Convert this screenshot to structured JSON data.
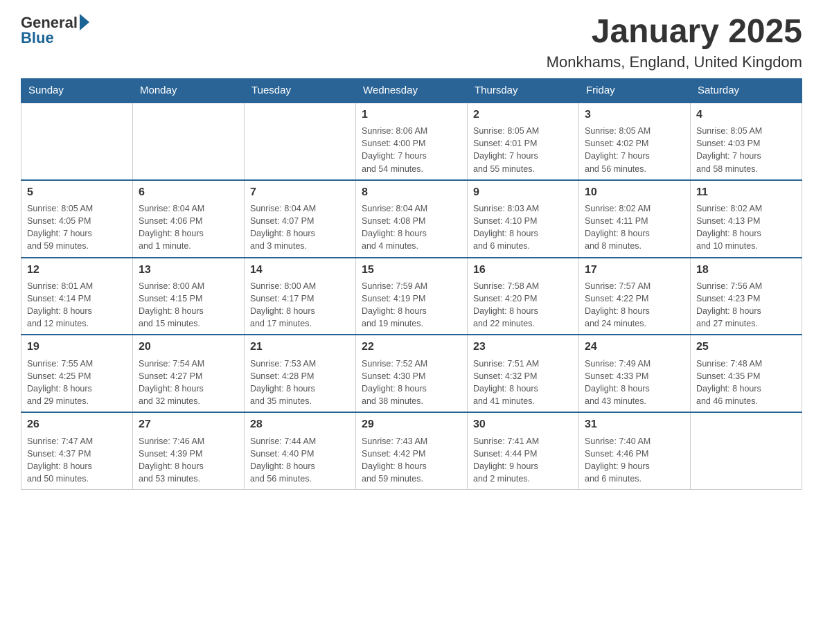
{
  "logo": {
    "text1": "General",
    "text2": "Blue"
  },
  "title": "January 2025",
  "subtitle": "Monkhams, England, United Kingdom",
  "days_of_week": [
    "Sunday",
    "Monday",
    "Tuesday",
    "Wednesday",
    "Thursday",
    "Friday",
    "Saturday"
  ],
  "weeks": [
    [
      {
        "day": "",
        "info": ""
      },
      {
        "day": "",
        "info": ""
      },
      {
        "day": "",
        "info": ""
      },
      {
        "day": "1",
        "info": "Sunrise: 8:06 AM\nSunset: 4:00 PM\nDaylight: 7 hours\nand 54 minutes."
      },
      {
        "day": "2",
        "info": "Sunrise: 8:05 AM\nSunset: 4:01 PM\nDaylight: 7 hours\nand 55 minutes."
      },
      {
        "day": "3",
        "info": "Sunrise: 8:05 AM\nSunset: 4:02 PM\nDaylight: 7 hours\nand 56 minutes."
      },
      {
        "day": "4",
        "info": "Sunrise: 8:05 AM\nSunset: 4:03 PM\nDaylight: 7 hours\nand 58 minutes."
      }
    ],
    [
      {
        "day": "5",
        "info": "Sunrise: 8:05 AM\nSunset: 4:05 PM\nDaylight: 7 hours\nand 59 minutes."
      },
      {
        "day": "6",
        "info": "Sunrise: 8:04 AM\nSunset: 4:06 PM\nDaylight: 8 hours\nand 1 minute."
      },
      {
        "day": "7",
        "info": "Sunrise: 8:04 AM\nSunset: 4:07 PM\nDaylight: 8 hours\nand 3 minutes."
      },
      {
        "day": "8",
        "info": "Sunrise: 8:04 AM\nSunset: 4:08 PM\nDaylight: 8 hours\nand 4 minutes."
      },
      {
        "day": "9",
        "info": "Sunrise: 8:03 AM\nSunset: 4:10 PM\nDaylight: 8 hours\nand 6 minutes."
      },
      {
        "day": "10",
        "info": "Sunrise: 8:02 AM\nSunset: 4:11 PM\nDaylight: 8 hours\nand 8 minutes."
      },
      {
        "day": "11",
        "info": "Sunrise: 8:02 AM\nSunset: 4:13 PM\nDaylight: 8 hours\nand 10 minutes."
      }
    ],
    [
      {
        "day": "12",
        "info": "Sunrise: 8:01 AM\nSunset: 4:14 PM\nDaylight: 8 hours\nand 12 minutes."
      },
      {
        "day": "13",
        "info": "Sunrise: 8:00 AM\nSunset: 4:15 PM\nDaylight: 8 hours\nand 15 minutes."
      },
      {
        "day": "14",
        "info": "Sunrise: 8:00 AM\nSunset: 4:17 PM\nDaylight: 8 hours\nand 17 minutes."
      },
      {
        "day": "15",
        "info": "Sunrise: 7:59 AM\nSunset: 4:19 PM\nDaylight: 8 hours\nand 19 minutes."
      },
      {
        "day": "16",
        "info": "Sunrise: 7:58 AM\nSunset: 4:20 PM\nDaylight: 8 hours\nand 22 minutes."
      },
      {
        "day": "17",
        "info": "Sunrise: 7:57 AM\nSunset: 4:22 PM\nDaylight: 8 hours\nand 24 minutes."
      },
      {
        "day": "18",
        "info": "Sunrise: 7:56 AM\nSunset: 4:23 PM\nDaylight: 8 hours\nand 27 minutes."
      }
    ],
    [
      {
        "day": "19",
        "info": "Sunrise: 7:55 AM\nSunset: 4:25 PM\nDaylight: 8 hours\nand 29 minutes."
      },
      {
        "day": "20",
        "info": "Sunrise: 7:54 AM\nSunset: 4:27 PM\nDaylight: 8 hours\nand 32 minutes."
      },
      {
        "day": "21",
        "info": "Sunrise: 7:53 AM\nSunset: 4:28 PM\nDaylight: 8 hours\nand 35 minutes."
      },
      {
        "day": "22",
        "info": "Sunrise: 7:52 AM\nSunset: 4:30 PM\nDaylight: 8 hours\nand 38 minutes."
      },
      {
        "day": "23",
        "info": "Sunrise: 7:51 AM\nSunset: 4:32 PM\nDaylight: 8 hours\nand 41 minutes."
      },
      {
        "day": "24",
        "info": "Sunrise: 7:49 AM\nSunset: 4:33 PM\nDaylight: 8 hours\nand 43 minutes."
      },
      {
        "day": "25",
        "info": "Sunrise: 7:48 AM\nSunset: 4:35 PM\nDaylight: 8 hours\nand 46 minutes."
      }
    ],
    [
      {
        "day": "26",
        "info": "Sunrise: 7:47 AM\nSunset: 4:37 PM\nDaylight: 8 hours\nand 50 minutes."
      },
      {
        "day": "27",
        "info": "Sunrise: 7:46 AM\nSunset: 4:39 PM\nDaylight: 8 hours\nand 53 minutes."
      },
      {
        "day": "28",
        "info": "Sunrise: 7:44 AM\nSunset: 4:40 PM\nDaylight: 8 hours\nand 56 minutes."
      },
      {
        "day": "29",
        "info": "Sunrise: 7:43 AM\nSunset: 4:42 PM\nDaylight: 8 hours\nand 59 minutes."
      },
      {
        "day": "30",
        "info": "Sunrise: 7:41 AM\nSunset: 4:44 PM\nDaylight: 9 hours\nand 2 minutes."
      },
      {
        "day": "31",
        "info": "Sunrise: 7:40 AM\nSunset: 4:46 PM\nDaylight: 9 hours\nand 6 minutes."
      },
      {
        "day": "",
        "info": ""
      }
    ]
  ]
}
